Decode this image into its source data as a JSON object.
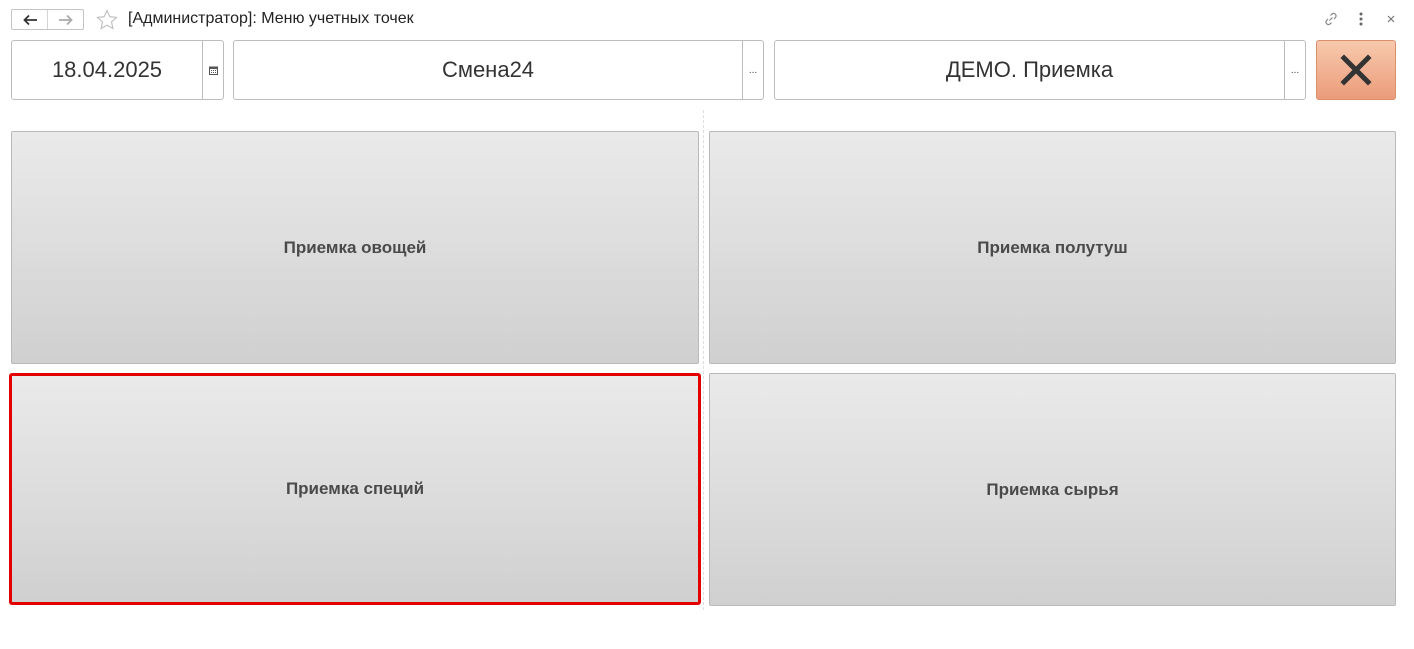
{
  "window": {
    "title": "[Администратор]: Меню учетных точек"
  },
  "fields": {
    "date": "18.04.2025",
    "shift": "Смена24",
    "point": "ДЕМО. Приемка",
    "more_glyph": "..."
  },
  "buttons": {
    "vegetables": "Приемка овощей",
    "carcasses": "Приемка полутуш",
    "spices": "Приемка специй",
    "raw": "Приемка сырья"
  },
  "colors": {
    "focus_border": "#e30000",
    "close_button": "#eb9c7a"
  },
  "icons": [
    "back-arrow-icon",
    "forward-arrow-icon",
    "star-icon",
    "link-icon",
    "more-vertical-icon",
    "close-icon",
    "calendar-icon",
    "x-icon"
  ]
}
